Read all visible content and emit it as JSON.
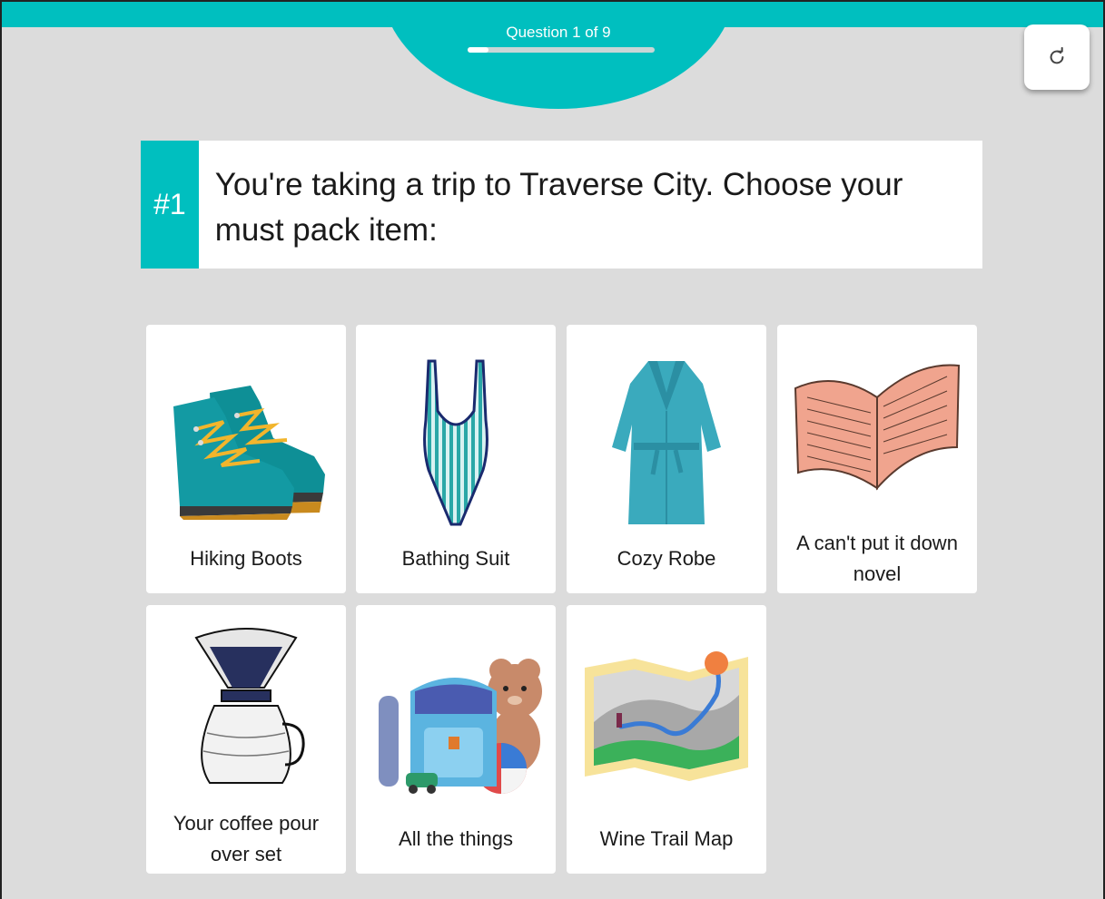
{
  "header": {
    "question_counter": "Question 1 of 9",
    "progress_fraction": 0.111
  },
  "toolbar": {
    "refresh_icon": "refresh-icon"
  },
  "question": {
    "number": "#1",
    "text": "You're taking a trip to Traverse City. Choose your must pack item:"
  },
  "options": [
    {
      "label": "Hiking Boots",
      "icon": "hiking-boots-icon"
    },
    {
      "label": "Bathing Suit",
      "icon": "bathing-suit-icon"
    },
    {
      "label": "Cozy Robe",
      "icon": "robe-icon"
    },
    {
      "label": "A can't put it down novel",
      "icon": "open-book-icon"
    },
    {
      "label": "Your coffee pour over set",
      "icon": "coffee-pour-over-icon"
    },
    {
      "label": "All the things",
      "icon": "backpack-toys-icon"
    },
    {
      "label": "Wine Trail Map",
      "icon": "trail-map-icon"
    }
  ],
  "colors": {
    "accent": "#00bfbf",
    "background": "#dcdcdc",
    "card": "#ffffff"
  }
}
